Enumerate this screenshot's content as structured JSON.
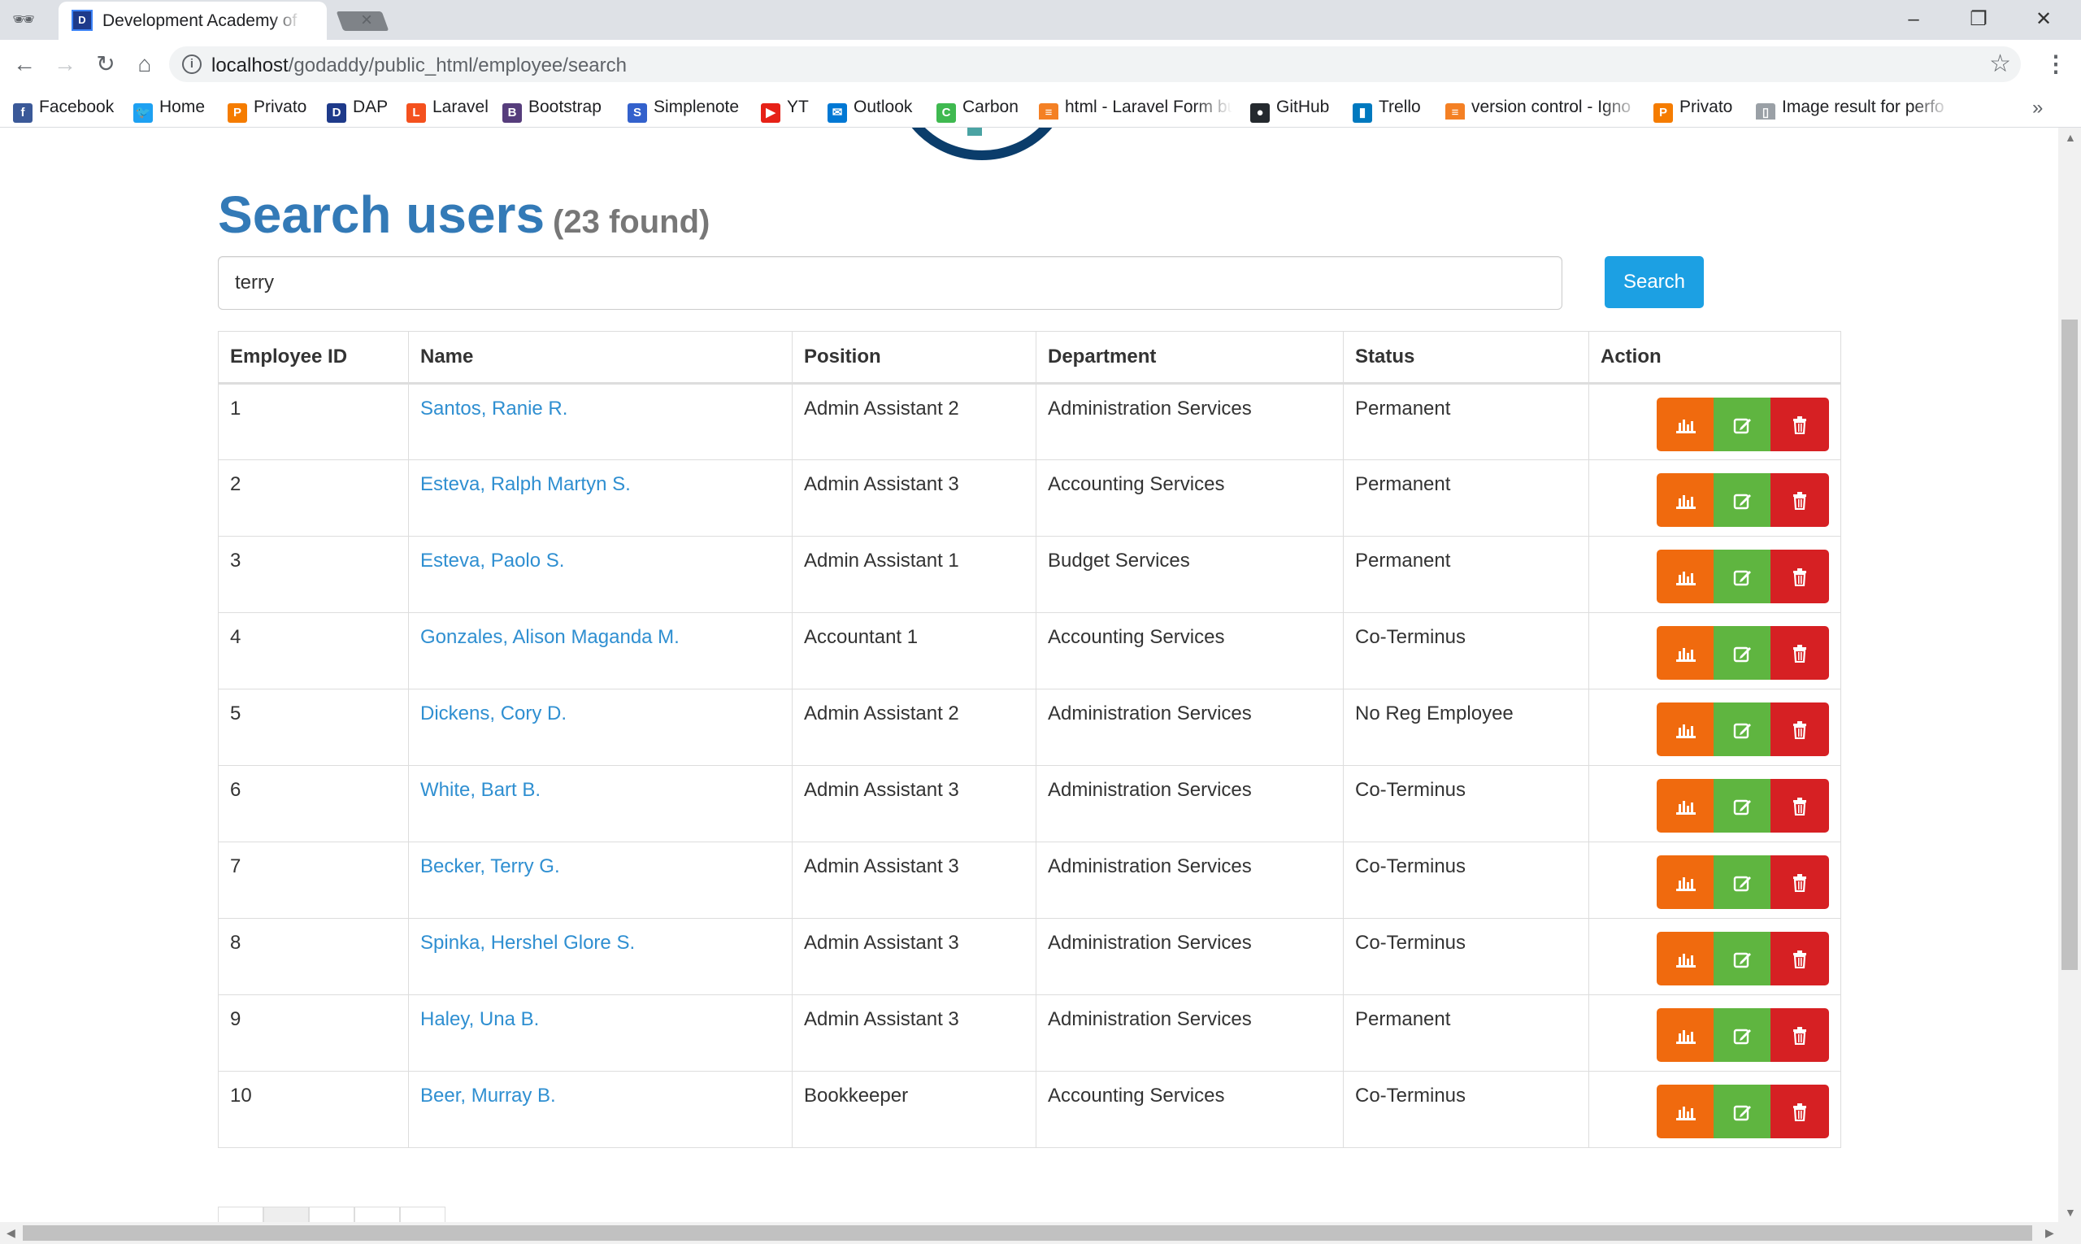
{
  "browser": {
    "tab_title": "Development Academy of the Philippines",
    "tab_favicon": "D",
    "url_host": "localhost",
    "url_path": "/godaddy/public_html/employee/search",
    "window_controls": {
      "minimize": "–",
      "restore": "❐",
      "close": "✕"
    },
    "close_tab": "×",
    "nav": {
      "back": "←",
      "forward": "→",
      "reload": "↻",
      "home": "⌂"
    },
    "star": "☆",
    "menu": "⋮",
    "bookmarks_more": "»",
    "bookmarks": [
      {
        "label": "Facebook",
        "icon": "facebook-icon",
        "glyph": "f",
        "color": "#3b5998"
      },
      {
        "label": "Home",
        "icon": "twitter-icon",
        "glyph": "🐦",
        "color": "#1da1f2"
      },
      {
        "label": "Privato",
        "icon": "privato-icon",
        "glyph": "P",
        "color": "#f57c00"
      },
      {
        "label": "DAP",
        "icon": "dap-icon",
        "glyph": "D",
        "color": "#1e3a8a"
      },
      {
        "label": "Laravel",
        "icon": "laravel-icon",
        "glyph": "L",
        "color": "#f4511e"
      },
      {
        "label": "Bootstrap",
        "icon": "bootstrap-icon",
        "glyph": "B",
        "color": "#563d7c"
      },
      {
        "label": "Simplenote",
        "icon": "simplenote-icon",
        "glyph": "S",
        "color": "#3361cc"
      },
      {
        "label": "YT",
        "icon": "youtube-icon",
        "glyph": "▶",
        "color": "#e62117"
      },
      {
        "label": "Outlook",
        "icon": "outlook-icon",
        "glyph": "✉",
        "color": "#0078d4"
      },
      {
        "label": "Carbon",
        "icon": "carbon-icon",
        "glyph": "C",
        "color": "#3fb950"
      },
      {
        "label": "html - Laravel Form bu",
        "icon": "stackoverflow-icon",
        "glyph": "≡",
        "color": "#f48024"
      },
      {
        "label": "GitHub",
        "icon": "github-icon",
        "glyph": "●",
        "color": "#24292e"
      },
      {
        "label": "Trello",
        "icon": "trello-icon",
        "glyph": "▮",
        "color": "#0079bf"
      },
      {
        "label": "version control - Igno",
        "icon": "stackoverflow-icon",
        "glyph": "≡",
        "color": "#f48024"
      },
      {
        "label": "Privato",
        "icon": "privato-icon",
        "glyph": "P",
        "color": "#f57c00"
      },
      {
        "label": "Image result for perfo",
        "icon": "page-icon",
        "glyph": "▯",
        "color": "#9aa0a6"
      }
    ]
  },
  "page": {
    "title": "Search users",
    "count": "(23 found)",
    "search": {
      "value": "terry",
      "button": "Search"
    },
    "table": {
      "headers": [
        "Employee ID",
        "Name",
        "Position",
        "Department",
        "Status",
        "Action"
      ],
      "rows": [
        {
          "id": "1",
          "name": "Santos, Ranie R.",
          "position": "Admin Assistant 2",
          "department": "Administration Services",
          "status": "Permanent"
        },
        {
          "id": "2",
          "name": "Esteva, Ralph Martyn S.",
          "position": "Admin Assistant 3",
          "department": "Accounting Services",
          "status": "Permanent"
        },
        {
          "id": "3",
          "name": "Esteva, Paolo S.",
          "position": "Admin Assistant 1",
          "department": "Budget Services",
          "status": "Permanent"
        },
        {
          "id": "4",
          "name": "Gonzales, Alison Maganda M.",
          "position": "Accountant 1",
          "department": "Accounting Services",
          "status": "Co-Terminus"
        },
        {
          "id": "5",
          "name": "Dickens, Cory D.",
          "position": "Admin Assistant 2",
          "department": "Administration Services",
          "status": "No Reg Employee"
        },
        {
          "id": "6",
          "name": "White, Bart B.",
          "position": "Admin Assistant 3",
          "department": "Administration Services",
          "status": "Co-Terminus"
        },
        {
          "id": "7",
          "name": "Becker, Terry G.",
          "position": "Admin Assistant 3",
          "department": "Administration Services",
          "status": "Co-Terminus"
        },
        {
          "id": "8",
          "name": "Spinka, Hershel Glore S.",
          "position": "Admin Assistant 3",
          "department": "Administration Services",
          "status": "Co-Terminus"
        },
        {
          "id": "9",
          "name": "Haley, Una B.",
          "position": "Admin Assistant 3",
          "department": "Administration Services",
          "status": "Permanent"
        },
        {
          "id": "10",
          "name": "Beer, Murray B.",
          "position": "Bookkeeper",
          "department": "Accounting Services",
          "status": "Co-Terminus"
        }
      ]
    },
    "colors": {
      "title": "#337ab7",
      "link": "#2f8fd1",
      "stats": "#f06a0e",
      "edit": "#5fb540",
      "delete": "#d62023",
      "search": "#1ca0e3"
    }
  }
}
